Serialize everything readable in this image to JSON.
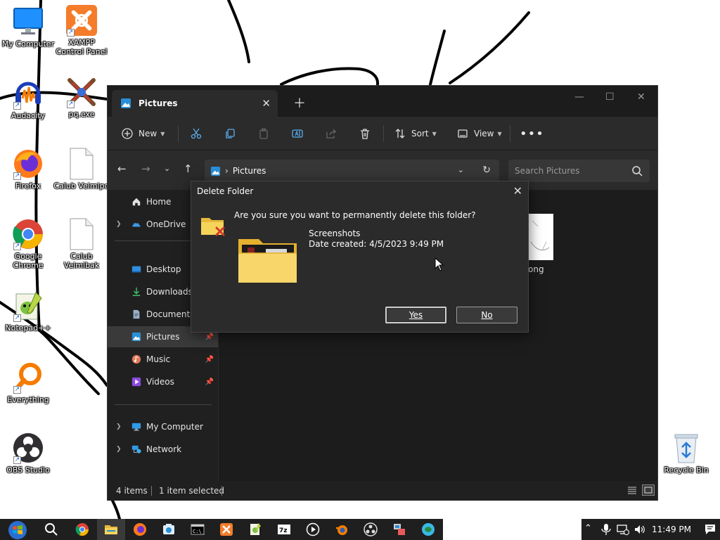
{
  "desktop": {
    "icons": [
      {
        "label": "My Computer",
        "icon": "computer-icon"
      },
      {
        "label": "XAMPP Control Panel",
        "icon": "xampp-icon"
      },
      {
        "label": "Audacity",
        "icon": "audacity-icon"
      },
      {
        "label": "pq.exe",
        "icon": "pq-exe-icon"
      },
      {
        "label": "Firefox",
        "icon": "firefox-icon"
      },
      {
        "label": "Calub Veimipq",
        "icon": "file-icon"
      },
      {
        "label": "Google Chrome",
        "icon": "chrome-icon"
      },
      {
        "label": "Calub Veimibak",
        "icon": "file-icon"
      },
      {
        "label": "Notepad++",
        "icon": "notepadpp-icon"
      },
      {
        "label": "Everything",
        "icon": "everything-icon"
      },
      {
        "label": "OBS Studio",
        "icon": "obs-icon"
      },
      {
        "label": "Recycle Bin",
        "icon": "recycle-bin-icon"
      }
    ]
  },
  "explorer": {
    "tab_title": "Pictures",
    "toolbar": {
      "new_label": "New",
      "sort_label": "Sort",
      "view_label": "View"
    },
    "address": {
      "crumb": "Pictures",
      "search_placeholder": "Search Pictures"
    },
    "nav": {
      "home": "Home",
      "onedrive": "OneDrive",
      "desktop": "Desktop",
      "downloads": "Downloads",
      "documents": "Documents",
      "pictures": "Pictures",
      "music": "Music",
      "videos": "Videos",
      "my_computer": "My Computer",
      "network": "Network"
    },
    "content": {
      "partial_item_label": "ong"
    },
    "status": {
      "items": "4 items",
      "selected": "1 item selected"
    }
  },
  "dialog": {
    "title": "Delete Folder",
    "question": "Are you sure you want to permanently delete this folder?",
    "folder_name": "Screenshots",
    "date_created": "Date created: 4/5/2023 9:49 PM",
    "yes_label": "Yes",
    "no_label": "No"
  },
  "taskbar": {
    "time": "11:49 PM"
  }
}
